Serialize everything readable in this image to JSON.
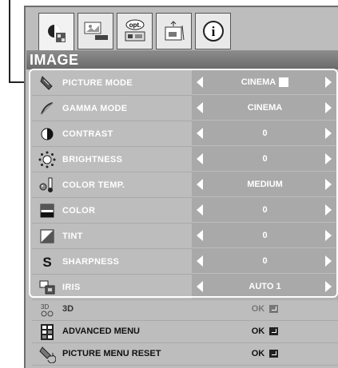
{
  "section_title": "IMAGE",
  "tabs": [
    {
      "name": "image-tab",
      "icon": "image-settings-icon",
      "active": true
    },
    {
      "name": "setting-tab",
      "icon": "projector-setting-icon",
      "active": false
    },
    {
      "name": "option-tab",
      "label": "opt.",
      "icon": "option-icon",
      "active": false
    },
    {
      "name": "install-tab",
      "icon": "installation-icon",
      "active": false
    },
    {
      "name": "info-tab",
      "label": "i",
      "icon": "info-icon",
      "active": false
    }
  ],
  "rows": [
    {
      "label": "PICTURE MODE",
      "value": "CINEMA",
      "icon": "picture-mode-icon"
    },
    {
      "label": "GAMMA MODE",
      "value": "CINEMA",
      "icon": "gamma-mode-icon"
    },
    {
      "label": "CONTRAST",
      "value": "0",
      "icon": "contrast-icon"
    },
    {
      "label": "BRIGHTNESS",
      "value": "0",
      "icon": "brightness-icon"
    },
    {
      "label": "COLOR TEMP.",
      "value": "MEDIUM",
      "icon": "color-temp-icon"
    },
    {
      "label": "COLOR",
      "value": "0",
      "icon": "color-icon"
    },
    {
      "label": "TINT",
      "value": "0",
      "icon": "tint-icon"
    },
    {
      "label": "SHARPNESS",
      "value": "0",
      "icon": "sharpness-icon"
    },
    {
      "label": "IRIS",
      "value": "AUTO 1",
      "icon": "iris-icon"
    }
  ],
  "lower_rows": [
    {
      "label": "3D",
      "value": "OK",
      "icon": "3d-icon"
    },
    {
      "label": "ADVANCED MENU",
      "value": "OK",
      "icon": "advanced-menu-icon"
    },
    {
      "label": "PICTURE MENU RESET",
      "value": "OK",
      "icon": "picture-reset-icon"
    }
  ]
}
